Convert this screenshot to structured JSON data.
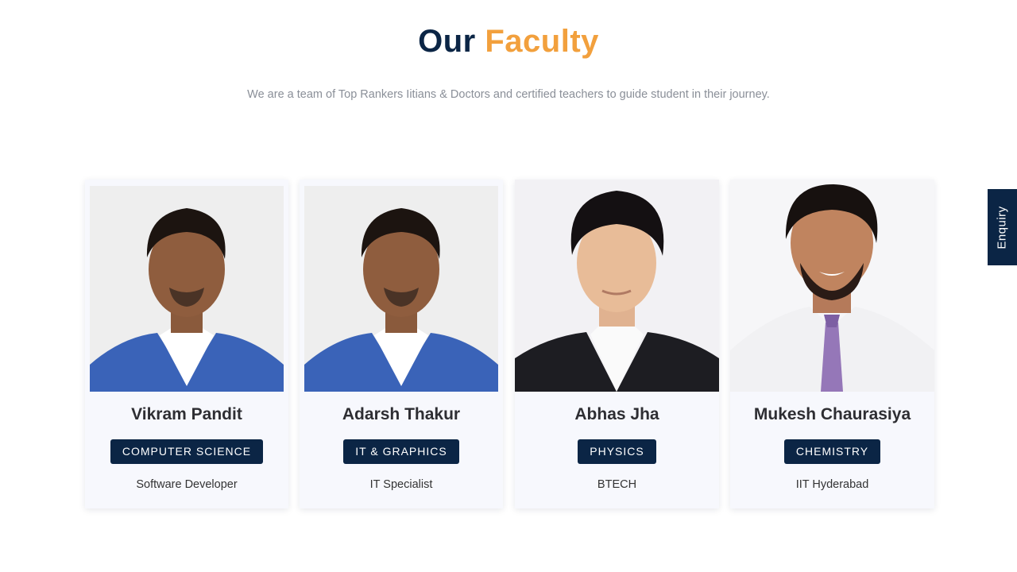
{
  "header": {
    "title_part1": "Our",
    "title_part2": "Faculty",
    "subtitle": "We are a team of Top Rankers Iitians & Doctors and certified teachers to guide student in their journey."
  },
  "faculty": [
    {
      "name": "Vikram Pandit",
      "subject": "COMPUTER SCIENCE",
      "role": "Software Developer"
    },
    {
      "name": "Adarsh Thakur",
      "subject": "IT & GRAPHICS",
      "role": "IT Specialist"
    },
    {
      "name": "Abhas Jha",
      "subject": "PHYSICS",
      "role": "BTECH"
    },
    {
      "name": "Mukesh Chaurasiya",
      "subject": "CHEMISTRY",
      "role": "IIT Hyderabad"
    }
  ],
  "enquiry": {
    "label": "Enquiry"
  },
  "colors": {
    "navy": "#0b2545",
    "accent_orange": "#f2a03d",
    "card_bg": "#f7f8fd"
  }
}
